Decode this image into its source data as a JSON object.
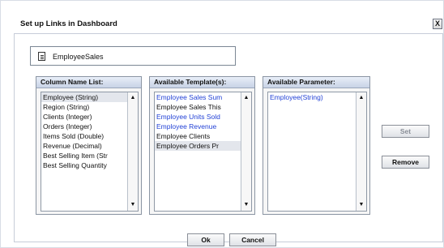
{
  "dialog": {
    "title": "Set up Links in Dashboard",
    "close_label": "X"
  },
  "dashboard": {
    "name": "EmployeeSales",
    "icon": "document-icon"
  },
  "column_list": {
    "title": "Column Name List:",
    "items": [
      "Employee (String)",
      "Region (String)",
      "Clients (Integer)",
      "Orders (Integer)",
      "Items Sold (Double)",
      "Revenue (Decimal)",
      "Best Selling Item (Str",
      "Best Selling Quantity"
    ],
    "selected_index": 0
  },
  "template_list": {
    "title": "Available Template(s):",
    "items": [
      "Employee Sales Sum",
      "Employee Sales This",
      "Employee Units Sold",
      "Employee Revenue",
      "Employee Clients",
      "Employee Orders Pr"
    ],
    "selected_index": 5
  },
  "parameter_list": {
    "title": "Available Parameter:",
    "items": [
      "Employee(String)"
    ]
  },
  "buttons": {
    "set": "Set",
    "remove": "Remove",
    "ok": "Ok",
    "cancel": "Cancel"
  },
  "colors": {
    "link_blue": "#2342d6",
    "header_start": "#e8eef8",
    "header_end": "#c8d3e6",
    "selection_bg": "#e3e6ec"
  }
}
